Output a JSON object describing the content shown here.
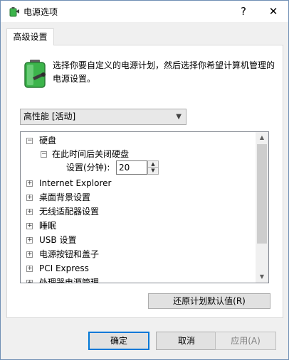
{
  "window": {
    "title": "电源选项",
    "help_glyph": "?",
    "close_glyph": "✕"
  },
  "tabs": [
    {
      "label": "高级设置",
      "active": true
    }
  ],
  "description": "选择你要自定义的电源计划，然后选择你希望计算机管理的电源设置。",
  "plan_select": {
    "value": "高性能 [活动]"
  },
  "tree": {
    "hard_disk": {
      "label": "硬盘",
      "expander": "⊟"
    },
    "turn_off_disk": {
      "label": "在此时间后关闭硬盘",
      "expander": "⊟"
    },
    "setting": {
      "label": "设置(分钟):",
      "value": "20"
    },
    "items": [
      {
        "label": "Internet Explorer",
        "expander": "⊞"
      },
      {
        "label": "桌面背景设置",
        "expander": "⊞"
      },
      {
        "label": "无线适配器设置",
        "expander": "⊞"
      },
      {
        "label": "睡眠",
        "expander": "⊞"
      },
      {
        "label": "USB 设置",
        "expander": "⊞"
      },
      {
        "label": "电源按钮和盖子",
        "expander": "⊞"
      },
      {
        "label": "PCI Express",
        "expander": "⊞"
      },
      {
        "label": "处理器电源管理",
        "expander": "⊞"
      }
    ]
  },
  "buttons": {
    "restore": "还原计划默认值(R)",
    "ok": "确定",
    "cancel": "取消",
    "apply": "应用(A)"
  },
  "colors": {
    "accent": "#0078d7",
    "battery_green": "#3cb44b"
  }
}
